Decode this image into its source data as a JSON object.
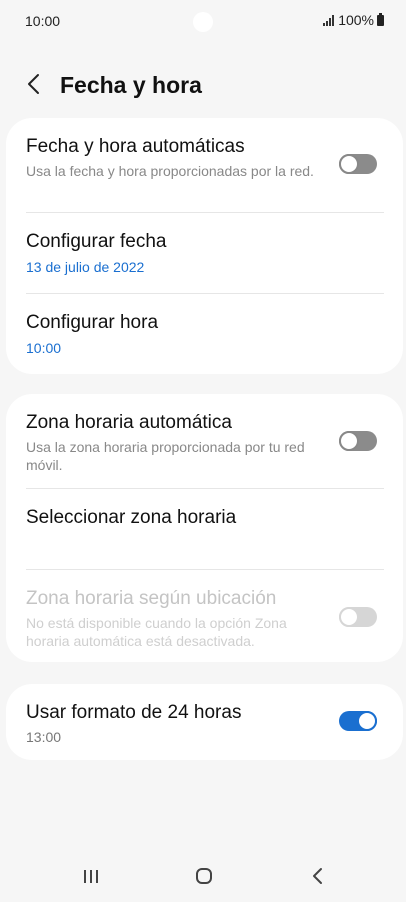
{
  "status_bar": {
    "time": "10:00",
    "battery_text": "100%",
    "icons": [
      "signal-icon",
      "battery-icon"
    ]
  },
  "header": {
    "back_icon": "back-arrow-icon",
    "title": "Fecha y hora"
  },
  "section1": {
    "auto_datetime": {
      "title": "Fecha y hora automáticas",
      "subtitle": "Usa la fecha y hora proporcionadas por la red.",
      "toggle_on": false
    },
    "set_date": {
      "title": "Configurar fecha",
      "value": "13 de julio de 2022"
    },
    "set_time": {
      "title": "Configurar hora",
      "value": "10:00"
    }
  },
  "section2": {
    "auto_timezone": {
      "title": "Zona horaria automática",
      "subtitle": "Usa la zona horaria proporcionada por tu red móvil.",
      "toggle_on": false
    },
    "select_timezone": {
      "title": "Seleccionar zona horaria"
    },
    "location_timezone": {
      "title": "Zona horaria según ubicación",
      "subtitle": "No está disponible cuando la opción Zona horaria automática está desactivada.",
      "toggle_on": false,
      "disabled": true
    }
  },
  "section3": {
    "format_24h": {
      "title": "Usar formato de 24 horas",
      "value": "13:00",
      "toggle_on": true
    }
  },
  "colors": {
    "accent": "#1a6fd0",
    "background": "#f6f6f6",
    "card": "#ffffff"
  },
  "navbar": {
    "icons": [
      "recent-apps-icon",
      "home-icon",
      "back-icon"
    ]
  }
}
